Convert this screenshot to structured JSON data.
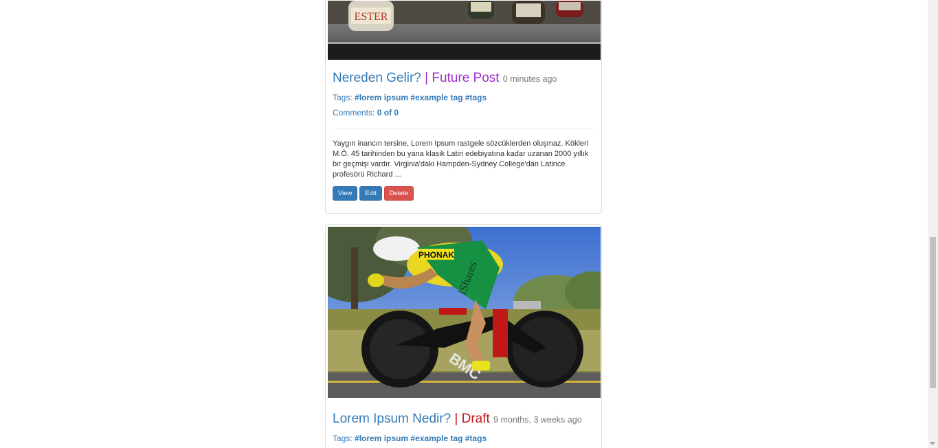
{
  "posts": [
    {
      "title": "Nereden Gelir?",
      "status_sep": " | ",
      "status": "Future Post",
      "time_ago": "0 minutes ago",
      "tags_label": "Tags:",
      "tags": [
        "#lorem ipsum",
        "#example tag",
        "#tags"
      ],
      "comments_label": "Comments:",
      "comments_value": "0 of 0",
      "excerpt": "Yaygın inancın tersine, Lorem Ipsum rastgele sözcüklerden oluşmaz. Kökleri M.Ö. 45 tarihinden bu yana klasik Latin edebiyatına kadar uzanan 2000 yıllık bir geçmişi vardır. Virginia'daki Hampden-Sydney College'dan Latince profesörü Richard ...",
      "buttons": {
        "view": "View",
        "edit": "Edit",
        "delete": "Delete"
      }
    },
    {
      "title": "Lorem Ipsum Nedir?",
      "status_sep": " | ",
      "status": "Draft",
      "time_ago": "9 months, 3 weeks ago",
      "tags_label": "Tags:",
      "tags": [
        "#lorem ipsum",
        "#example tag",
        "#tags"
      ]
    }
  ],
  "image_labels": {
    "bottle_label": "ESTER",
    "jersey_brand": "PHONAK",
    "jersey_sponsor": "iShares",
    "bike_brand": "BMC"
  },
  "colors": {
    "link": "#337ab7",
    "future": "#9b30c9",
    "draft": "#c0171b",
    "danger": "#d9534f"
  }
}
